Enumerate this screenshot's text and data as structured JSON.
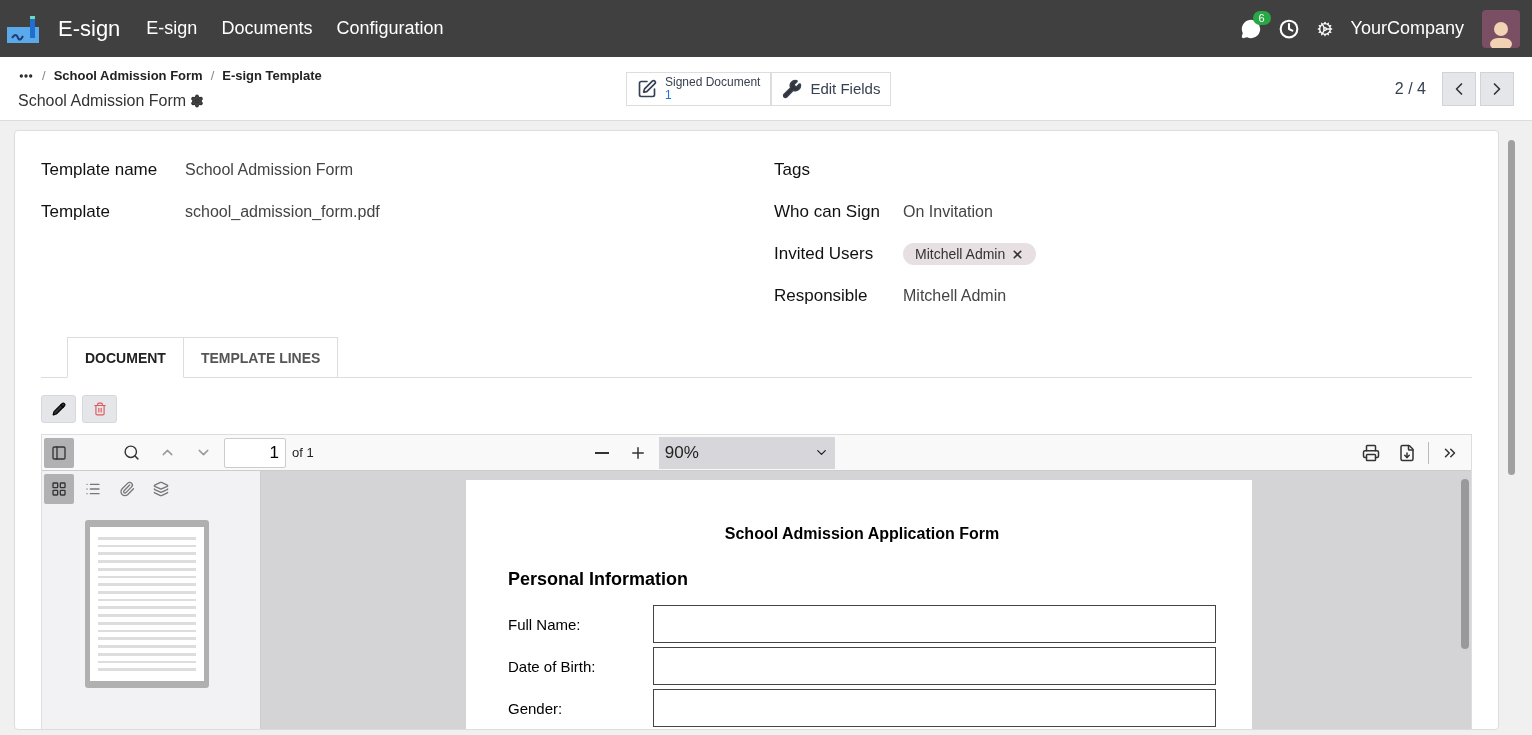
{
  "navbar": {
    "app_name": "E-sign",
    "menu": [
      "E-sign",
      "Documents",
      "Configuration"
    ],
    "messages_count": "6",
    "company": "YourCompany"
  },
  "breadcrumbs": {
    "separator": "/",
    "items": [
      "School Admission Form",
      "E-sign Template"
    ],
    "title": "School Admission Form"
  },
  "actions": [
    {
      "kind": "stat",
      "label": "Signed Document",
      "value": "1"
    },
    {
      "kind": "button",
      "label": "Edit Fields"
    }
  ],
  "pager": "2 / 4",
  "form": {
    "left": [
      {
        "kind": "text",
        "label": "Template name",
        "value": "School Admission Form"
      },
      {
        "kind": "text",
        "label": "Template",
        "value": "school_admission_form.pdf"
      }
    ],
    "right": [
      {
        "kind": "empty",
        "label": "Tags"
      },
      {
        "kind": "text",
        "label": "Who can Sign",
        "value": "On Invitation"
      },
      {
        "kind": "tags",
        "label": "Invited Users",
        "tags": [
          "Mitchell Admin"
        ]
      },
      {
        "kind": "text",
        "label": "Responsible",
        "value": "Mitchell Admin"
      }
    ]
  },
  "tabs": [
    {
      "label": "DOCUMENT",
      "selected": true
    },
    {
      "label": "TEMPLATE LINES",
      "selected": false
    }
  ],
  "viewer": {
    "page_input": "1",
    "page_count": "of 1",
    "zoom": "90%"
  },
  "pdf": {
    "title": "School Admission Application Form",
    "section": "Personal Information",
    "fields": [
      "Full Name:",
      "Date of Birth:",
      "Gender:"
    ]
  }
}
